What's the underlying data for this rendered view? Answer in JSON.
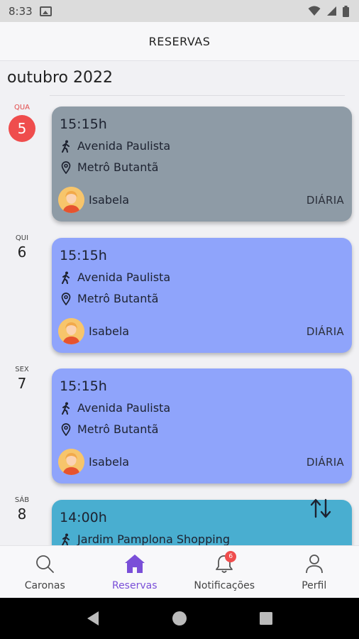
{
  "status_bar": {
    "time": "8:33"
  },
  "header": {
    "title": "RESERVAS"
  },
  "month": "outubro 2022",
  "days": [
    {
      "abbr": "QUA",
      "num": "5",
      "today": true
    },
    {
      "abbr": "QUI",
      "num": "6"
    },
    {
      "abbr": "SEX",
      "num": "7"
    },
    {
      "abbr": "SÁB",
      "num": "8"
    }
  ],
  "cards": [
    {
      "time": "15:15h",
      "origin": "Avenida Paulista",
      "destination": "Metrô Butantã",
      "user": "Isabela",
      "type": "DIÁRIA",
      "color": "#8e9ba6"
    },
    {
      "time": "15:15h",
      "origin": "Avenida Paulista",
      "destination": "Metrô Butantã",
      "user": "Isabela",
      "type": "DIÁRIA",
      "color": "#8fa4fb"
    },
    {
      "time": "15:15h",
      "origin": "Avenida Paulista",
      "destination": "Metrô Butantã",
      "user": "Isabela",
      "type": "DIÁRIA",
      "color": "#8fa4fb"
    },
    {
      "time": "14:00h",
      "origin": "Jardim Pamplona Shopping",
      "color": "#49aed0"
    }
  ],
  "tabs": [
    {
      "label": "Caronas",
      "icon": "search-icon"
    },
    {
      "label": "Reservas",
      "icon": "home-icon",
      "active": true
    },
    {
      "label": "Notificações",
      "icon": "bell-icon",
      "badge": "6"
    },
    {
      "label": "Perfil",
      "icon": "person-icon"
    }
  ],
  "colors": {
    "accent": "#7a4fd8",
    "today": "#ef4d4d"
  }
}
